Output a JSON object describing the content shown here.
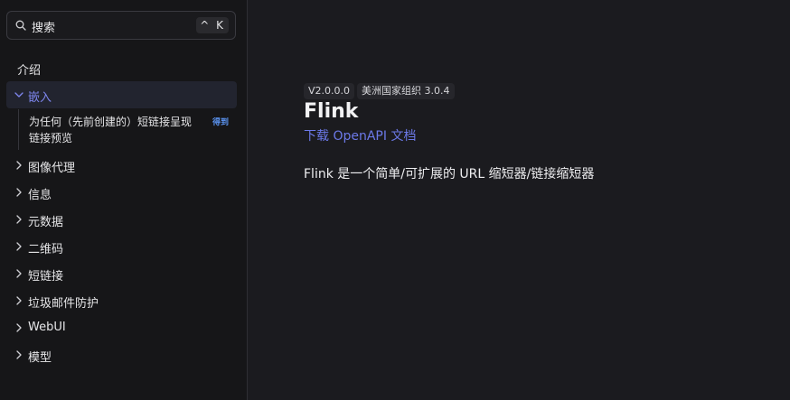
{
  "search": {
    "placeholder": "搜索",
    "shortcut": "^ K"
  },
  "sidebar": {
    "section_title": "介绍",
    "items": [
      {
        "label": "嵌入",
        "expanded": true,
        "active": true
      },
      {
        "label": "图像代理"
      },
      {
        "label": "信息"
      },
      {
        "label": "元数据"
      },
      {
        "label": "二维码"
      },
      {
        "label": "短链接"
      },
      {
        "label": "垃圾邮件防护"
      },
      {
        "label": "WebUI"
      },
      {
        "label": "模型"
      }
    ],
    "sub_item": {
      "label": "为任何（先前创建的）短链接呈现链接预览",
      "method": "得到",
      "method_color": "#5b93f0"
    }
  },
  "main": {
    "version_tag": "V2.0.0.0",
    "org_tag": "美洲国家组织 3.0.4",
    "title": "Flink",
    "download_link": "下载 OpenAPI 文档",
    "description": "Flink 是一个简单/可扩展的 URL 缩短器/链接缩短器"
  },
  "colors": {
    "background": "#1b1b1f",
    "sidebar": "#161618",
    "accent": "#6c79e8",
    "active_bg": "#22242f"
  }
}
